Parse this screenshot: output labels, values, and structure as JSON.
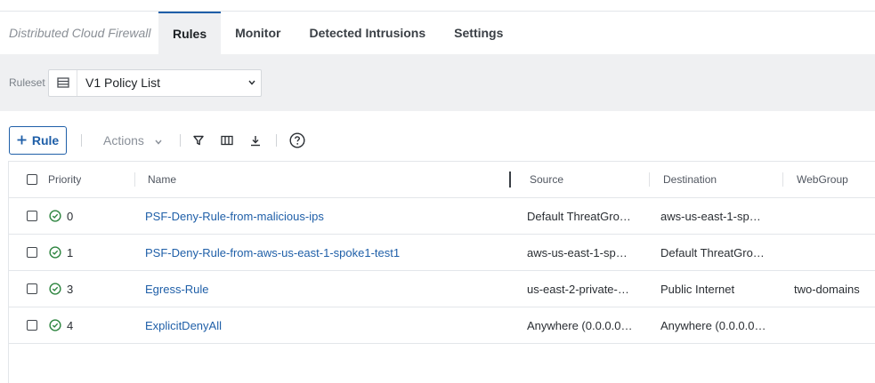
{
  "nav": {
    "product": "Distributed Cloud Firewall",
    "tabs": [
      {
        "label": "Rules",
        "active": true
      },
      {
        "label": "Monitor",
        "active": false
      },
      {
        "label": "Detected Intrusions",
        "active": false
      },
      {
        "label": "Settings",
        "active": false
      }
    ]
  },
  "ruleset": {
    "label": "Ruleset",
    "value": "V1 Policy List"
  },
  "toolbar": {
    "add_rule_label": "Rule",
    "actions_label": "Actions"
  },
  "table": {
    "headers": {
      "priority": "Priority",
      "name": "Name",
      "source": "Source",
      "destination": "Destination",
      "webgroup": "WebGroup"
    },
    "rows": [
      {
        "priority": "0",
        "name": "PSF-Deny-Rule-from-malicious-ips",
        "source": "Default ThreatGro…",
        "destination": "aws-us-east-1-sp…",
        "webgroup": ""
      },
      {
        "priority": "1",
        "name": "PSF-Deny-Rule-from-aws-us-east-1-spoke1-test1",
        "source": "aws-us-east-1-sp…",
        "destination": "Default ThreatGro…",
        "webgroup": ""
      },
      {
        "priority": "3",
        "name": "Egress-Rule",
        "source": "us-east-2-private-…",
        "destination": "Public Internet",
        "webgroup": "two-domains"
      },
      {
        "priority": "4",
        "name": "ExplicitDenyAll",
        "source": "Anywhere (0.0.0.0…",
        "destination": "Anywhere (0.0.0.0…",
        "webgroup": ""
      }
    ]
  },
  "colors": {
    "accent": "#1f5fa8",
    "status_ok": "#2e8540",
    "toolbar_bg": "#eff0f2"
  }
}
